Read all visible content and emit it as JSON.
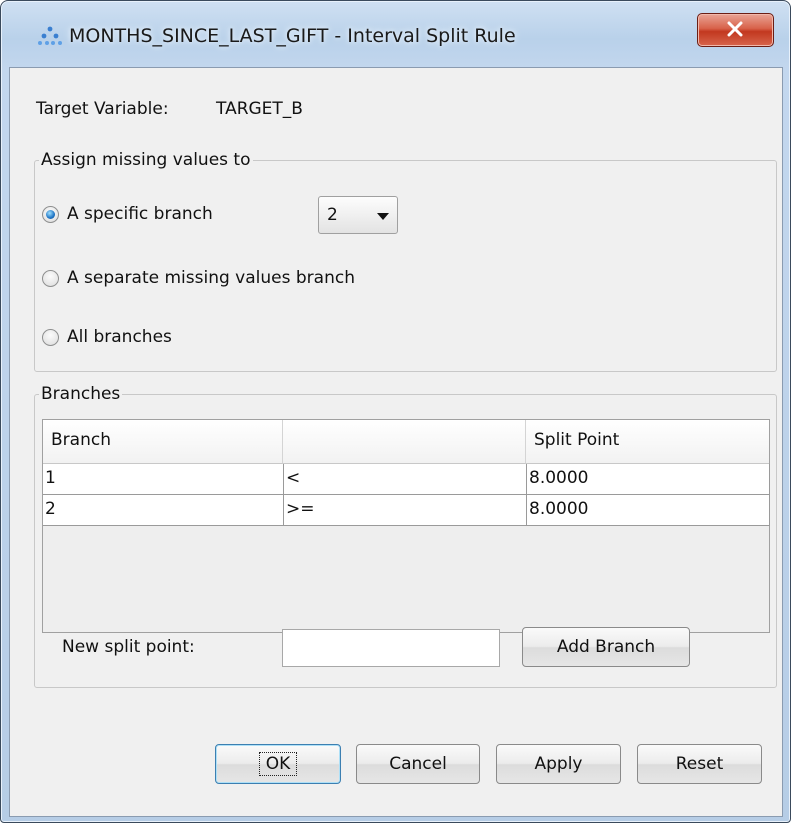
{
  "window": {
    "title": "MONTHS_SINCE_LAST_GIFT - Interval Split Rule"
  },
  "target": {
    "label": "Target Variable:",
    "value": "TARGET_B"
  },
  "missing_group": {
    "legend": "Assign missing values to",
    "options": [
      {
        "label": "A specific branch",
        "selected": true
      },
      {
        "label": "A separate missing values branch",
        "selected": false
      },
      {
        "label": "All branches",
        "selected": false
      }
    ],
    "branch_select": "2"
  },
  "branches_group": {
    "legend": "Branches",
    "columns": [
      "Branch",
      "",
      "Split Point"
    ],
    "rows": [
      {
        "branch": "1",
        "op": "<",
        "split": "8.0000"
      },
      {
        "branch": "2",
        "op": ">=",
        "split": "8.0000"
      }
    ],
    "new_split_label": "New split point:",
    "new_split_value": "",
    "add_branch_label": "Add Branch"
  },
  "buttons": {
    "ok": "OK",
    "cancel": "Cancel",
    "apply": "Apply",
    "reset": "Reset"
  },
  "colors": {
    "close_button": "#c9442b",
    "radio_selected": "#1f74c4"
  }
}
